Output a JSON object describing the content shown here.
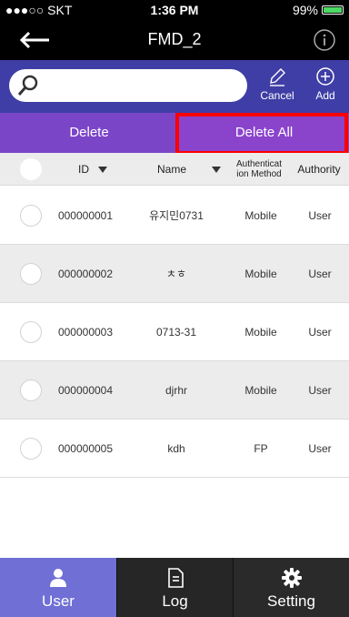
{
  "status_bar": {
    "carrier": "●●●○○ SKT",
    "time": "1:36 PM",
    "battery": "99%",
    "battery_level": 0.99
  },
  "nav": {
    "title": "FMD_2",
    "back_icon": "arrow-left-icon",
    "info_icon": "info-icon"
  },
  "toolbar": {
    "search_value": "",
    "search_placeholder": "",
    "cancel_label": "Cancel",
    "add_label": "Add"
  },
  "delete_bar": {
    "delete_label": "Delete",
    "delete_all_label": "Delete All"
  },
  "table": {
    "headers": {
      "id": "ID",
      "name": "Name",
      "auth_method": "Authenticat ion Method",
      "authority": "Authority"
    },
    "rows": [
      {
        "id": "000000001",
        "name": "유지민0731",
        "auth": "Mobile",
        "authority": "User"
      },
      {
        "id": "000000002",
        "name": "ㅊㅎ",
        "auth": "Mobile",
        "authority": "User"
      },
      {
        "id": "000000003",
        "name": "0713-31",
        "auth": "Mobile",
        "authority": "User"
      },
      {
        "id": "000000004",
        "name": "djrhr",
        "auth": "Mobile",
        "authority": "User"
      },
      {
        "id": "000000005",
        "name": "kdh",
        "auth": "FP",
        "authority": "User"
      }
    ]
  },
  "tabs": [
    {
      "label": "User",
      "icon": "user-icon",
      "active": true
    },
    {
      "label": "Log",
      "icon": "document-icon",
      "active": false
    },
    {
      "label": "Setting",
      "icon": "gear-icon",
      "active": false
    }
  ],
  "colors": {
    "toolbar": "#3f3ea6",
    "delete_bar": "#7f3fc4",
    "highlight": "#ff0000",
    "tab_active": "#6f6fd6"
  }
}
